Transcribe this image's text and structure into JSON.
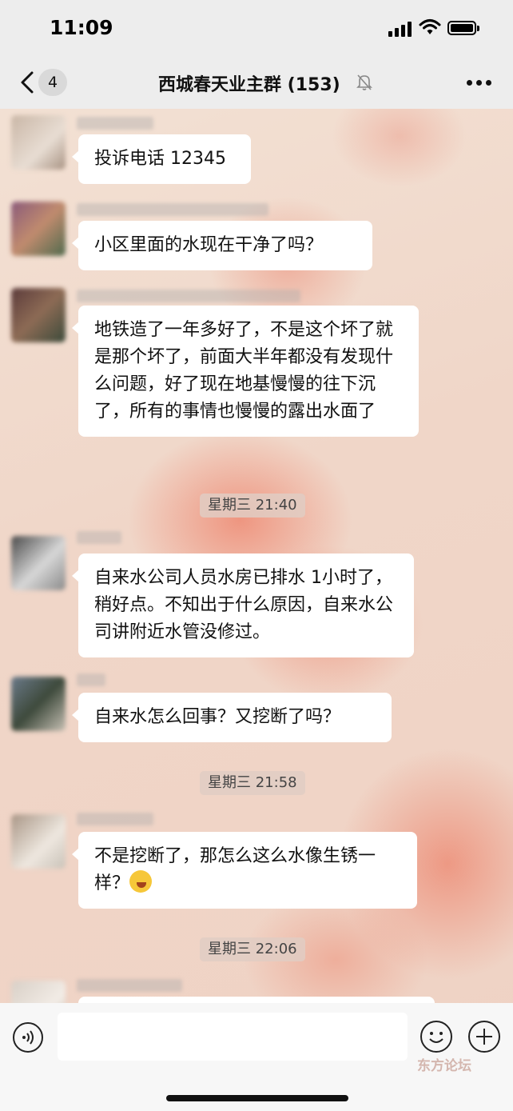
{
  "status_bar": {
    "time": "11:09"
  },
  "nav": {
    "back_badge": "4",
    "title": "西城春天业主群 (153)"
  },
  "messages": [
    {
      "text": "投诉电话 12345"
    },
    {
      "text": "小区里面的水现在干净了吗？"
    },
    {
      "text": "地铁造了一年多好了，不是这个坏了就是那个坏了，前面大半年都没有发现什么问题，好了现在地基慢慢的往下沉了，所有的事情也慢慢的露出水面了"
    },
    {
      "text": "自来水公司人员水房已排水 1小时了，稍好点。不知出于什么原因，自来水公司讲附近水管没修过。"
    },
    {
      "text": "自来水怎么回事？又挖断了吗？"
    },
    {
      "text": "不是挖断了，那怎么这么水像生锈一样？"
    }
  ],
  "timestamps": [
    "星期三 21:40",
    "星期三 21:58",
    "星期三 22:06"
  ],
  "emoji": "face-with-tears-of-joy",
  "watermark": "东方论坛",
  "icons": {
    "back": "chevron-left-icon",
    "mute": "bell-muted-icon",
    "more": "more-dots-icon",
    "voice": "voice-icon",
    "emoji": "smiley-icon",
    "add": "plus-icon"
  }
}
